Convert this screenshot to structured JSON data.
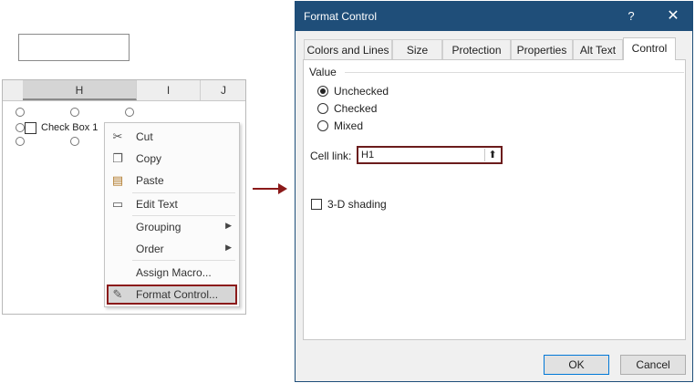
{
  "spreadsheet": {
    "columns": [
      "H",
      "I",
      "J"
    ],
    "checkbox_label": "Check Box 1"
  },
  "context_menu": {
    "items": [
      {
        "label": "Cut",
        "icon": "scissors-icon"
      },
      {
        "label": "Copy",
        "icon": "copy-icon"
      },
      {
        "label": "Paste",
        "icon": "paste-icon"
      },
      {
        "label": "Edit Text",
        "icon": "edit-text-icon"
      },
      {
        "label": "Grouping",
        "submenu": true
      },
      {
        "label": "Order",
        "submenu": true
      },
      {
        "label": "Assign Macro...",
        "icon": ""
      },
      {
        "label": "Format Control...",
        "icon": "format-control-icon",
        "highlighted": true
      }
    ]
  },
  "dialog": {
    "title": "Format Control",
    "help": "?",
    "close": "✕",
    "tabs": [
      "Colors and Lines",
      "Size",
      "Protection",
      "Properties",
      "Alt Text",
      "Control"
    ],
    "active_tab": "Control",
    "value_group": "Value",
    "radios": [
      {
        "label": "Unchecked",
        "checked": true
      },
      {
        "label": "Checked",
        "checked": false
      },
      {
        "label": "Mixed",
        "checked": false
      }
    ],
    "cell_link_label": "Cell link:",
    "cell_link_value": "H1",
    "collapse_icon": "⬆",
    "shading_label": "3-D shading",
    "ok": "OK",
    "cancel": "Cancel"
  },
  "colors": {
    "titlebar": "#1f4e79",
    "highlight_border": "#8b1a1a",
    "arrow": "#8b1a1a"
  }
}
